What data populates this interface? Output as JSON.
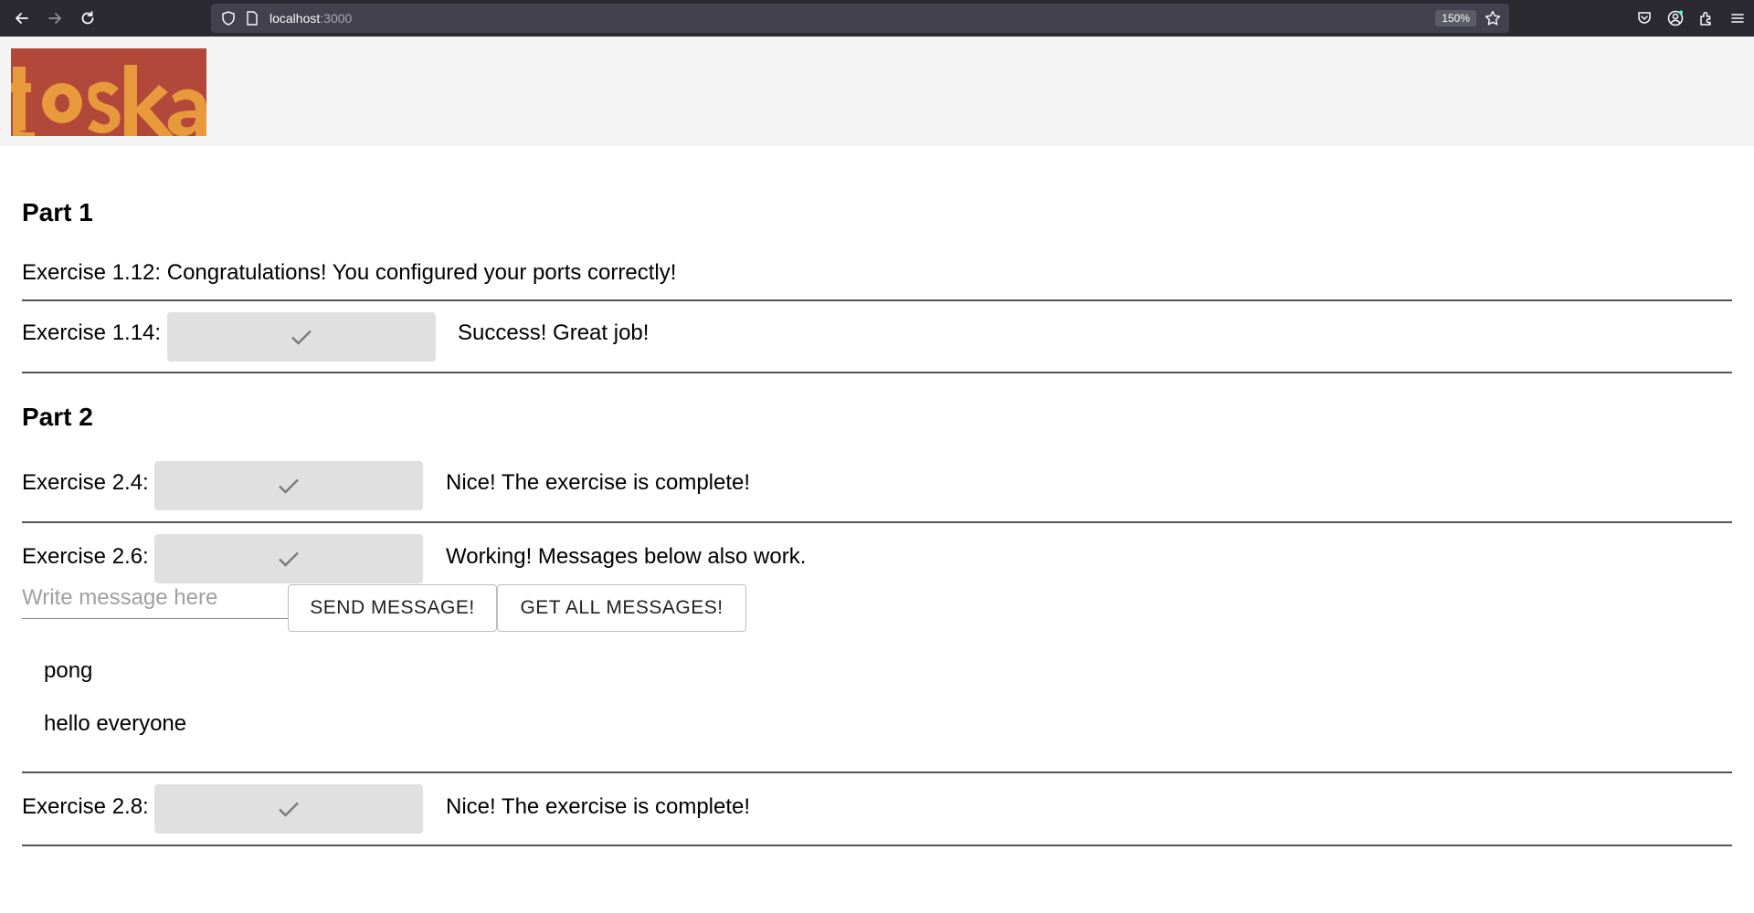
{
  "browser": {
    "url_host": "localhost",
    "url_port": ":3000",
    "zoom": "150%"
  },
  "logo": {
    "name": "toska",
    "colors": {
      "primary": "#e8993c",
      "secondary": "#b1483a"
    }
  },
  "part1": {
    "title": "Part 1",
    "ex112": {
      "text": "Exercise 1.12: Congratulations! You configured your ports correctly!"
    },
    "ex114": {
      "label": "Exercise 1.14:",
      "status": "Success! Great job!"
    }
  },
  "part2": {
    "title": "Part 2",
    "ex24": {
      "label": "Exercise 2.4:",
      "status": "Nice! The exercise is complete!"
    },
    "ex26": {
      "label": "Exercise 2.6:",
      "status": "Working! Messages below also work.",
      "input_placeholder": "Write message here",
      "input_value": "",
      "send_label": "SEND MESSAGE!",
      "get_all_label": "GET ALL MESSAGES!",
      "messages": [
        "pong",
        "hello everyone"
      ]
    },
    "ex28": {
      "label": "Exercise 2.8:",
      "status": "Nice! The exercise is complete!"
    }
  },
  "icons": {
    "check": "check-icon",
    "back": "back-arrow-icon",
    "forward": "forward-arrow-icon",
    "reload": "reload-icon",
    "bookmark": "star-icon"
  }
}
